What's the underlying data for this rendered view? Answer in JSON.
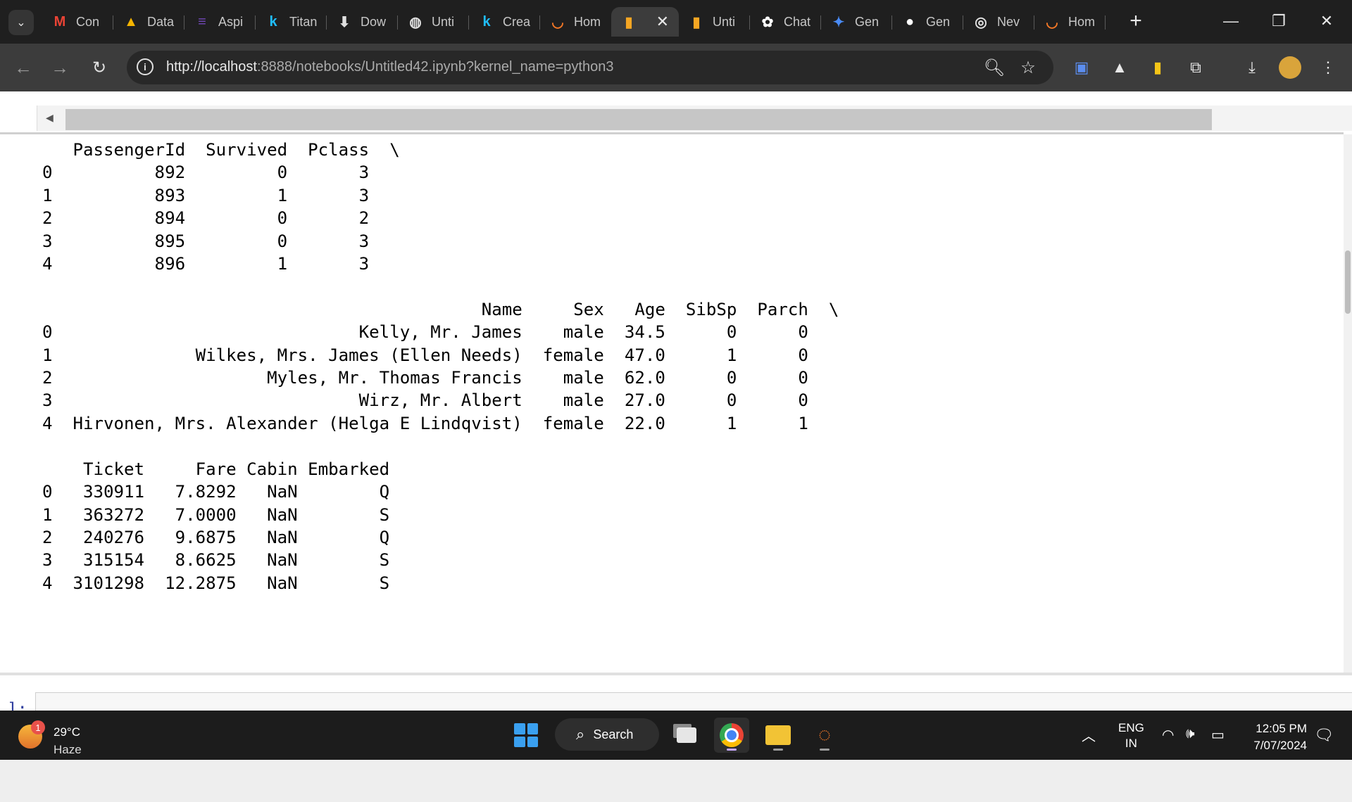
{
  "tabs": [
    {
      "label": "Con",
      "icon": "gmail-icon",
      "glyph": "M",
      "color": "#ea4335"
    },
    {
      "label": "Data",
      "icon": "google-drive-icon",
      "glyph": "▲",
      "color": "#f4b400"
    },
    {
      "label": "Aspi",
      "icon": "forms-icon",
      "glyph": "≡",
      "color": "#7248b9"
    },
    {
      "label": "Titan",
      "icon": "kaggle-icon",
      "glyph": "k",
      "color": "#20beff"
    },
    {
      "label": "Dow",
      "icon": "download-icon",
      "glyph": "⬇",
      "color": "#e0e0e0"
    },
    {
      "label": "Unti",
      "icon": "globe-icon",
      "glyph": "◍",
      "color": "#e0e0e0"
    },
    {
      "label": "Crea",
      "icon": "kaggle-icon",
      "glyph": "k",
      "color": "#20beff"
    },
    {
      "label": "Hom",
      "icon": "jupyter-icon",
      "glyph": "◡",
      "color": "#f37726"
    },
    {
      "label": "",
      "icon": "notebook-icon",
      "glyph": "▮",
      "color": "#f5a623",
      "active": true
    },
    {
      "label": "Unti",
      "icon": "notebook-icon",
      "glyph": "▮",
      "color": "#f5a623"
    },
    {
      "label": "Chat",
      "icon": "chatgpt-icon",
      "glyph": "✿",
      "color": "#ffffff"
    },
    {
      "label": "Gen",
      "icon": "gemini-icon",
      "glyph": "✦",
      "color": "#4a8bf5"
    },
    {
      "label": "Gen",
      "icon": "github-icon",
      "glyph": "●",
      "color": "#ffffff"
    },
    {
      "label": "Nev",
      "icon": "chrome-icon",
      "glyph": "◎",
      "color": "#e0e0e0"
    },
    {
      "label": "Hom",
      "icon": "jupyter-icon",
      "glyph": "◡",
      "color": "#f37726"
    }
  ],
  "toolbar": {
    "url_host": "http://localhost",
    "url_path": ":8888/notebooks/Untitled42.ipynb?kernel_name=python3"
  },
  "output": {
    "text": "   PassengerId  Survived  Pclass  \\\n0          892         0       3   \n1          893         1       3   \n2          894         0       2   \n3          895         0       3   \n4          896         1       3   \n\n                                           Name     Sex   Age  SibSp  Parch  \\\n0                              Kelly, Mr. James    male  34.5      0      0   \n1              Wilkes, Mrs. James (Ellen Needs)  female  47.0      1      0   \n2                     Myles, Mr. Thomas Francis    male  62.0      0      0   \n3                              Wirz, Mr. Albert    male  27.0      0      0   \n4  Hirvonen, Mrs. Alexander (Helga E Lindqvist)  female  22.0      1      1   \n\n    Ticket     Fare Cabin Embarked  \n0   330911   7.8292   NaN        Q  \n1   363272   7.0000   NaN        S  \n2   240276   9.6875   NaN        Q  \n3   315154   8.6625   NaN        S  \n4  3101298  12.2875   NaN        S  "
  },
  "cell": {
    "prompt": "]:"
  },
  "taskbar": {
    "weather_temp": "29°C",
    "weather_condition": "Haze",
    "weather_badge": "1",
    "search_label": "Search",
    "lang_top": "ENG",
    "lang_bottom": "IN",
    "time": "12:05 PM",
    "date": "7/07/2024"
  }
}
